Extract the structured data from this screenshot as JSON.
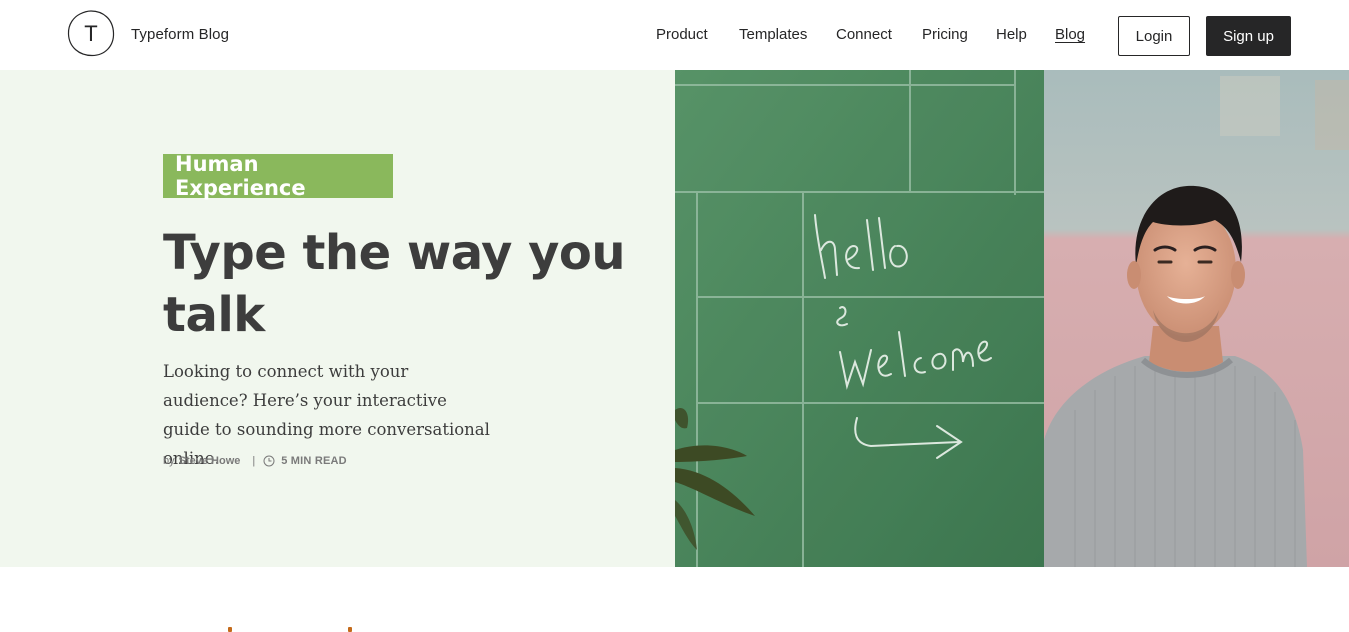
{
  "header": {
    "logo_letter": "T",
    "brand": "Typeform Blog",
    "nav": [
      {
        "label": "Product"
      },
      {
        "label": "Templates"
      },
      {
        "label": "Connect"
      },
      {
        "label": "Pricing"
      },
      {
        "label": "Help"
      },
      {
        "label": "Blog",
        "active": true
      }
    ],
    "login_label": "Login",
    "signup_label": "Sign up"
  },
  "hero": {
    "category": "Human Experience",
    "title": "Type the way you talk",
    "subtitle": "Looking to connect with your audience? Here’s your interactive guide to sounding more conversational online.",
    "by_label": "by",
    "author": "Steve Howe",
    "separator": "|",
    "read_time": "5 MIN READ",
    "clock_icon": "clock-icon"
  },
  "colors": {
    "hero_bg": "#f1f7ee",
    "category_bg": "#8ab85c",
    "signup_bg": "#262627",
    "text": "#3d3d3d"
  }
}
